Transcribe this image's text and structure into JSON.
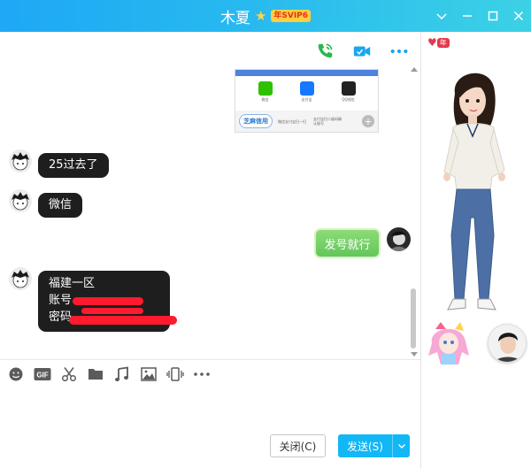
{
  "window": {
    "title": "木夏",
    "vip_badge": "年SVIP6"
  },
  "colors": {
    "titlebar_start": "#1ea8f5",
    "titlebar_end": "#3cd1e6",
    "send_button": "#12b7f5",
    "bubble_dark": "#1e1e1e",
    "bubble_green": "#62c75a"
  },
  "header_icons": [
    "phone-call-icon",
    "video-call-icon",
    "more-icon"
  ],
  "image_message": {
    "apps": [
      {
        "label": "微信"
      },
      {
        "label": "支付宝"
      },
      {
        "label": "QQ钱包"
      }
    ],
    "brand": "芝麻信用",
    "hint1": "微信支付宝扫一扫",
    "hint2": "支付宝扫二维码确认账号"
  },
  "messages": [
    {
      "from": "other",
      "text": "25过去了"
    },
    {
      "from": "other",
      "text": "微信"
    },
    {
      "from": "self",
      "text": "发号就行"
    },
    {
      "from": "other",
      "lines": [
        "福建一区",
        "账号",
        "密码"
      ]
    }
  ],
  "input": {
    "value": "",
    "placeholder": ""
  },
  "buttons": {
    "close": "关闭(C)",
    "send": "发送(S)"
  },
  "side_panel": {
    "year_badge": "年"
  }
}
